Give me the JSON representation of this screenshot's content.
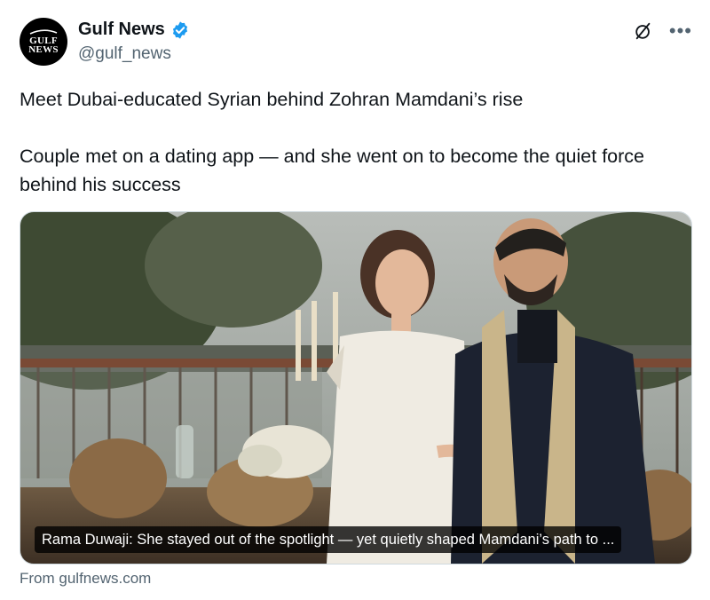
{
  "author": {
    "display_name": "Gulf News",
    "handle": "@gulf_news",
    "avatar_text_line1": "GULF",
    "avatar_text_line2": "NEWS",
    "verified": true
  },
  "icons": {
    "verified": "verified-badge-icon",
    "grok": "grok-icon",
    "more": "more-options-icon"
  },
  "tweet": {
    "line1": "Meet Dubai-educated Syrian behind Zohran Mamdani’s rise",
    "line2": "Couple met on a dating app — and she went on to become the quiet force behind his success"
  },
  "card": {
    "caption": "Rama Duwaji: She stayed out of the spotlight — yet quietly shaped Mamdani’s path to ...",
    "source": "From gulfnews.com"
  },
  "colors": {
    "verified_blue": "#1d9bf0",
    "text_primary": "#0f1419",
    "text_secondary": "#536471"
  }
}
